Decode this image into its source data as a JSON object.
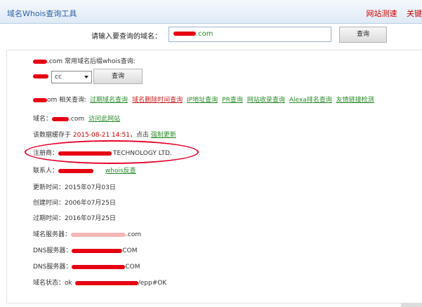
{
  "header": {
    "title": "域名Whois查询工具",
    "links": [
      "网站测速",
      "关键"
    ]
  },
  "search": {
    "label": "请输入要查询的域名：",
    "value": ".com",
    "button": "查询"
  },
  "suffix_query": {
    "label_pre": ".com 常用域名后缀whois查询:",
    "select_value": "cc",
    "button": "查询"
  },
  "related": {
    "label": "om 相关查询:",
    "links": [
      {
        "text": "过期域名查询",
        "kind": "green"
      },
      {
        "text": "域名删除时间查询",
        "kind": "red"
      },
      {
        "text": "IP地址查询",
        "kind": "green"
      },
      {
        "text": "PR查询",
        "kind": "green"
      },
      {
        "text": "网站收录查询",
        "kind": "green"
      },
      {
        "text": "Alexa排名查询",
        "kind": "green"
      },
      {
        "text": "友情链接检测",
        "kind": "green"
      }
    ]
  },
  "domain": {
    "label": "域名：",
    "value": ".com",
    "visit": "访问此网站"
  },
  "cache": {
    "pre": "该数据缓存于",
    "time": "2015-08-21 14:51",
    "mid": "，点击",
    "refresh": "强制更新"
  },
  "registrar": {
    "label": "注册商：",
    "value": "TECHNOLOGY LTD."
  },
  "contact": {
    "label": "联系人：",
    "reverse": "whois反查"
  },
  "updated": {
    "label": "更新时间：",
    "value": "2015年07月03日"
  },
  "created": {
    "label": "创建时间：",
    "value": "2006年07月25日"
  },
  "expires": {
    "label": "过期时间：",
    "value": "2016年07月25日"
  },
  "server": {
    "label": "域名服务器：",
    "value": ".com"
  },
  "dns1": {
    "label": "DNS服务器：",
    "value": "COM"
  },
  "dns2": {
    "label": "DNS服务器：",
    "value": "COM"
  },
  "status": {
    "label": "域名状态：",
    "value": "ok",
    "value_tail": "/epp#OK"
  },
  "colors": {
    "accent": "#2b5ea9",
    "link_green": "#2b8a2b",
    "alert_red": "#cc0000",
    "redaction": "#e60012"
  }
}
